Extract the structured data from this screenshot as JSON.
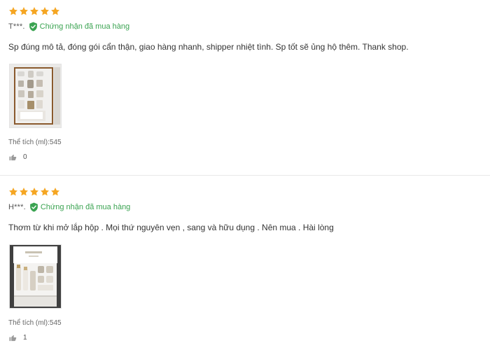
{
  "colors": {
    "star": "#f5a623",
    "verified": "#3aa351",
    "divider": "#e8e8e8"
  },
  "reviews": [
    {
      "stars": 5,
      "author": "T***.",
      "verified_text": "Chứng nhận đã mua hàng",
      "comment": "Sp đúng mô tả, đóng gói cẩn thận, giao hàng nhanh, shipper nhiệt tình. Sp tốt sẽ ủng hộ thêm. Thank shop.",
      "variant": "Thể tích (ml):545",
      "likes": "0"
    },
    {
      "stars": 5,
      "author": "H***.",
      "verified_text": "Chứng nhận đã mua hàng",
      "comment": "Thơm từ khi mở lắp hộp . Mọi thứ nguyên vẹn , sang và hữu dụng . Nên mua . Hài lòng",
      "variant": "Thể tích (ml):545",
      "likes": "1"
    }
  ]
}
